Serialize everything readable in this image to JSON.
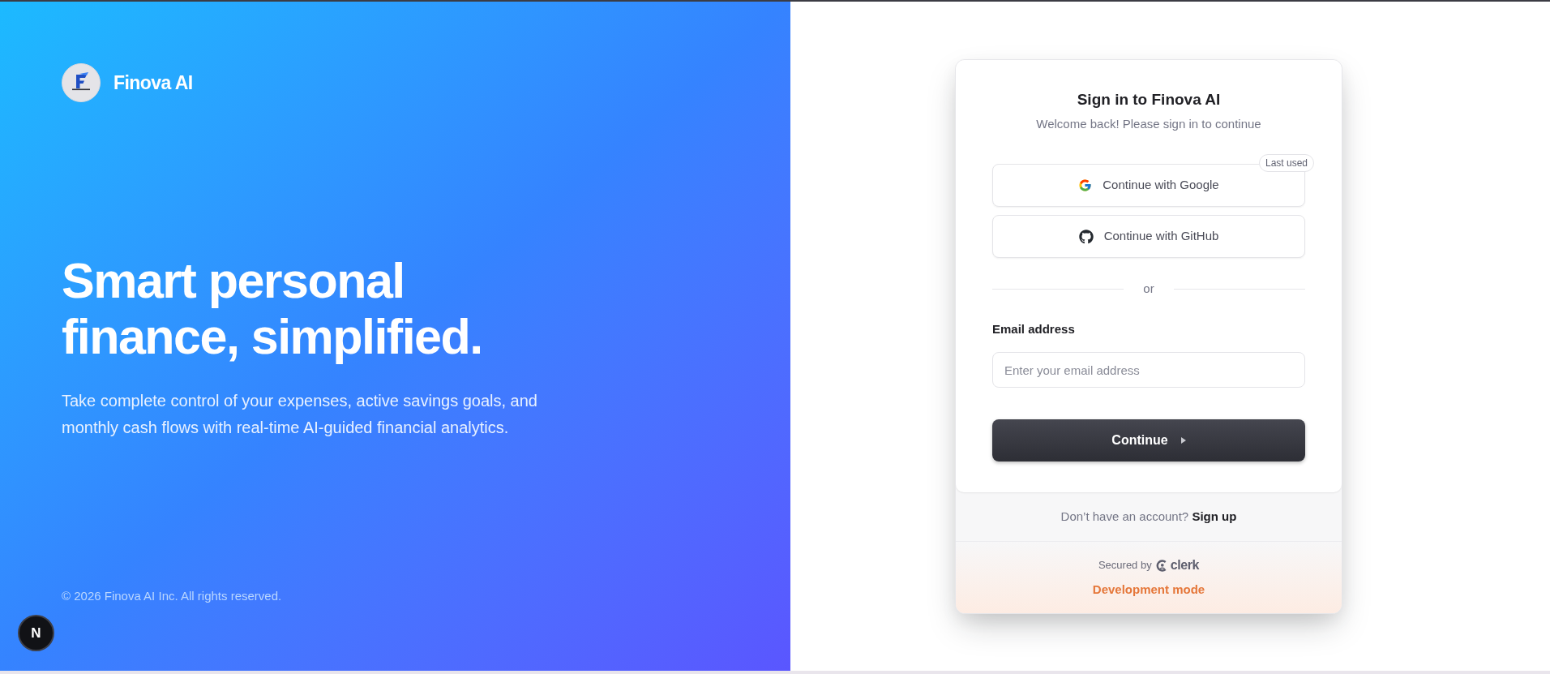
{
  "brand": {
    "name": "Finova AI"
  },
  "hero": {
    "headline": "Smart personal finance, simplified.",
    "description": "Take complete control of your expenses, active savings goals, and monthly cash flows with real-time AI-guided financial analytics."
  },
  "footer": {
    "copyright": "© 2026 Finova AI Inc. All rights reserved."
  },
  "dev_indicator": {
    "label": "N"
  },
  "sign_in": {
    "title": "Sign in to Finova AI",
    "subtitle": "Welcome back! Please sign in to continue",
    "providers": [
      {
        "kind": "google",
        "label": "Continue with Google",
        "last_used": true
      },
      {
        "kind": "github",
        "label": "Continue with GitHub",
        "last_used": false
      }
    ],
    "last_used_badge": "Last used",
    "divider": "or",
    "email": {
      "label": "Email address",
      "placeholder": "Enter your email address"
    },
    "submit": "Continue",
    "signup_prompt": "Don’t have an account?",
    "signup_link": "Sign up",
    "secured_by": "Secured by",
    "secured_brand": "clerk",
    "mode": "Development mode"
  }
}
